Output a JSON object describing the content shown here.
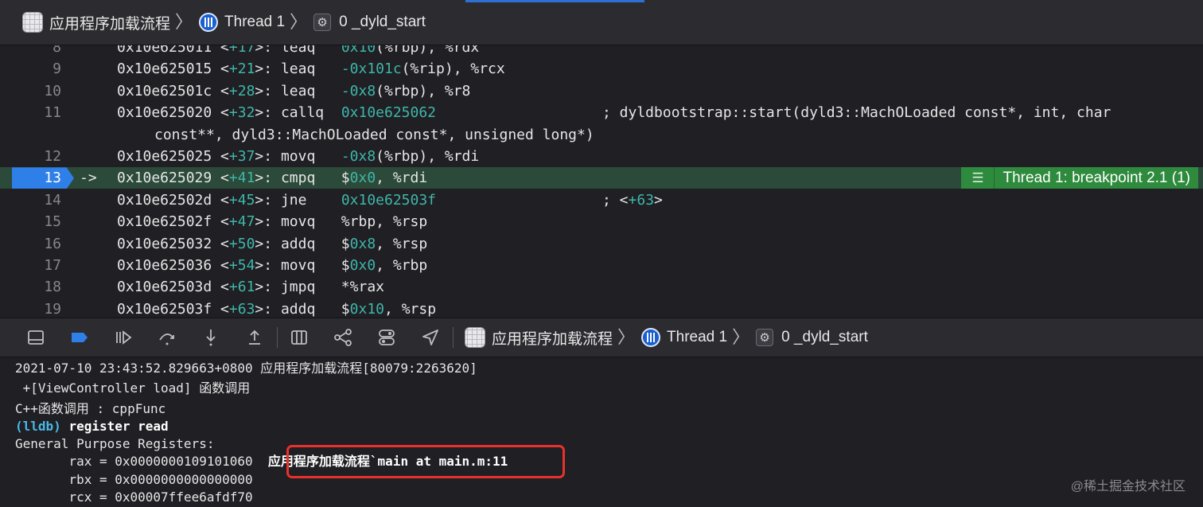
{
  "breadcrumb": {
    "app": "应用程序加载流程",
    "thread": "Thread 1",
    "frame": "0 _dyld_start"
  },
  "code_rows": [
    {
      "line": "8",
      "addr": "0x10e625011",
      "off": "+17",
      "op": "leaq  ",
      "arg_pre": " ",
      "arg_hex": "0x10",
      "arg_post": "(%rbp), %rdx"
    },
    {
      "line": "9",
      "addr": "0x10e625015",
      "off": "+21",
      "op": "leaq  ",
      "arg_pre": " ",
      "arg_hex": "-0x101c",
      "arg_post": "(%rip), %rcx"
    },
    {
      "line": "10",
      "addr": "0x10e62501c",
      "off": "+28",
      "op": "leaq  ",
      "arg_pre": " ",
      "arg_hex": "-0x8",
      "arg_post": "(%rbp), %r8"
    },
    {
      "line": "11",
      "addr": "0x10e625020",
      "off": "+32",
      "op": "callq ",
      "arg_pre": " ",
      "arg_hex": "0x10e625062",
      "arg_post": "",
      "comment": "; dyldbootstrap::start(dyld3::MachOLoaded const*, int, char",
      "wrap": "const**, dyld3::MachOLoaded const*, unsigned long*)"
    },
    {
      "line": "12",
      "addr": "0x10e625025",
      "off": "+37",
      "op": "movq  ",
      "arg_pre": " ",
      "arg_hex": "-0x8",
      "arg_post": "(%rbp), %rdi"
    },
    {
      "line": "13",
      "addr": "0x10e625029",
      "off": "+41",
      "op": "cmpq  ",
      "arg_pre": " $",
      "arg_hex": "0x0",
      "arg_post": ", %rdi",
      "current": true,
      "arrow": "->"
    },
    {
      "line": "14",
      "addr": "0x10e62502d",
      "off": "+45",
      "op": "jne   ",
      "arg_pre": " ",
      "arg_hex": "0x10e62503f",
      "arg_post": "",
      "comment_pre": "; <",
      "comment_hex": "+63",
      "comment_post": ">"
    },
    {
      "line": "15",
      "addr": "0x10e62502f",
      "off": "+47",
      "op": "movq  ",
      "arg_pre": " %rbp, %rsp",
      "arg_hex": "",
      "arg_post": ""
    },
    {
      "line": "16",
      "addr": "0x10e625032",
      "off": "+50",
      "op": "addq  ",
      "arg_pre": " $",
      "arg_hex": "0x8",
      "arg_post": ", %rsp"
    },
    {
      "line": "17",
      "addr": "0x10e625036",
      "off": "+54",
      "op": "movq  ",
      "arg_pre": " $",
      "arg_hex": "0x0",
      "arg_post": ", %rbp"
    },
    {
      "line": "18",
      "addr": "0x10e62503d",
      "off": "+61",
      "op": "jmpq  ",
      "arg_pre": " *%rax",
      "arg_hex": "",
      "arg_post": ""
    },
    {
      "line": "19",
      "addr": "0x10e62503f",
      "off": "+63",
      "op": "addq  ",
      "arg_pre": " $",
      "arg_hex": "0x10",
      "arg_post": ", %rsp"
    }
  ],
  "thread_badge": "Thread 1: breakpoint 2.1 (1)",
  "toolbar": {
    "app": "应用程序加载流程",
    "thread": "Thread 1",
    "frame": "0 _dyld_start"
  },
  "console": {
    "log1": "2021-07-10 23:43:52.829663+0800 应用程序加载流程[80079:2263620]",
    "log2": " +[ViewController load] 函数调用",
    "log3": "C++函数调用 : cppFunc",
    "prompt": "(lldb)",
    "command": "register read",
    "header": "General Purpose Registers:",
    "regs": [
      {
        "name": "rax",
        "value": "0x0000000109101060",
        "note": "应用程序加载流程`main at main.m:11"
      },
      {
        "name": "rbx",
        "value": "0x0000000000000000"
      },
      {
        "name": "rcx",
        "value": "0x00007ffee6afdf70"
      }
    ]
  },
  "watermark": "@稀土掘金技术社区",
  "colors": {
    "hex_literal": "#3fb6a8",
    "current_line": "#2c4a3a",
    "breakpoint": "#2f7fe8",
    "thread_badge": "#2e8a3d",
    "highlight_box": "#e8312c"
  }
}
